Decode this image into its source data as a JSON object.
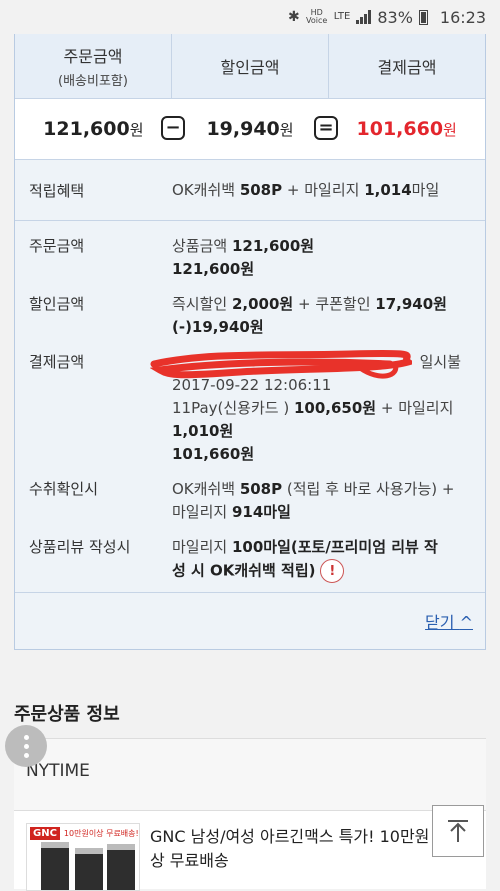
{
  "status_bar": {
    "hd_voice": "HD Voice",
    "network": "LTE",
    "battery": "83%",
    "time": "16:23"
  },
  "summary": {
    "headers": {
      "order": "주문금액",
      "order_sub": "(배송비포함)",
      "discount": "할인금액",
      "payment": "결제금액"
    },
    "values": {
      "order": "121,600",
      "discount": "19,940",
      "payment": "101,660",
      "won": "원"
    },
    "ops": {
      "minus": "−",
      "equals": "="
    }
  },
  "reward": {
    "label": "적립혜택",
    "p1": "OK캐쉬백 ",
    "p1b": "508P",
    "p2": " + 마일리지 ",
    "p2b": "1,014",
    "p3": "마일"
  },
  "details": {
    "order": {
      "label": "주문금액",
      "line1_pre": "상품금액 ",
      "line1_bold": "121,600원",
      "line2": "121,600원"
    },
    "discount": {
      "label": "할인금액",
      "l1a": "즉시할인 ",
      "l1b": "2,000원",
      "l1c": " + 쿠폰할인 ",
      "l1d": "17,940원",
      "l2": "(-)19,940원"
    },
    "payment": {
      "label": "결제금액",
      "l1": "일시불",
      "l2": "2017-09-22 12:06:11",
      "l3a": "11Pay(신용카드 ) ",
      "l3b": "100,650원",
      "l3c": " + 마일리지",
      "l4": "1,010원",
      "l5": "101,660원"
    },
    "receipt": {
      "label": "수취확인시",
      "l1a": "OK캐쉬백 ",
      "l1b": "508P",
      "l1c": " (적립 후 바로 사용가능) +",
      "l2a": "마일리지 ",
      "l2b": "914마일"
    },
    "review": {
      "label": "상품리뷰 작성시",
      "l1a": "마일리지 ",
      "l1b": "100마일(포토/프리미엄 리뷰 작",
      "l2": "성 시 OK캐쉬백 적립)"
    }
  },
  "close_label": "닫기",
  "section_title": "주문상품 정보",
  "seller_name": "NYTIME",
  "product": {
    "name": "GNC 남성/여성 아르긴맥스 특가! 10만원 이상 무료배송",
    "thumb_logo": "GNC",
    "thumb_promo": "10만원이상 무료배송!"
  },
  "colors": {
    "accent_red": "#e3262d",
    "link_blue": "#2a5fb0",
    "panel_border": "#b9cbe2"
  },
  "icons": [
    "bluetooth-icon",
    "signal-icon",
    "battery-icon",
    "minus-icon",
    "equals-icon",
    "warning-icon",
    "chevron-up-icon",
    "more-vertical-icon",
    "scroll-top-icon"
  ]
}
